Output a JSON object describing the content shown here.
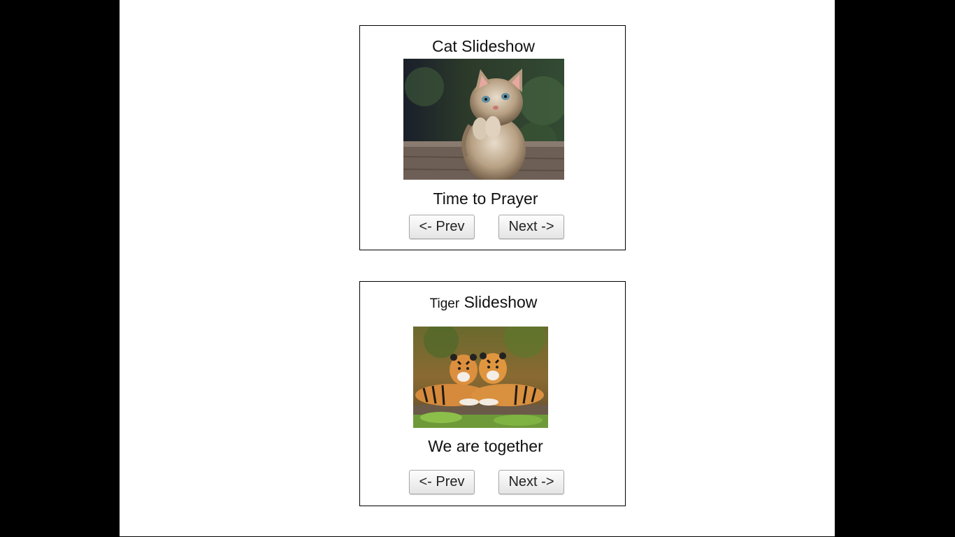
{
  "cat_slideshow": {
    "title": "Cat Slideshow",
    "image_alt": "kitten with paws together",
    "caption": "Time to Prayer",
    "prev_label": "<- Prev",
    "next_label": "Next ->"
  },
  "tiger_slideshow": {
    "title_small": "Tiger",
    "title_rest": "Slideshow",
    "image_alt": "two tiger cubs",
    "caption": "We are together",
    "prev_label": "<- Prev",
    "next_label": "Next ->"
  },
  "colors": {
    "page_background": "#ffffff",
    "side_background": "#000000",
    "border": "#000000"
  }
}
